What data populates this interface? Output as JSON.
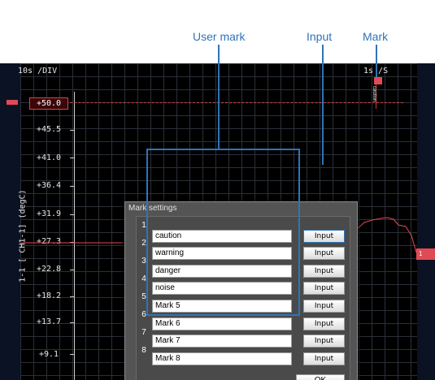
{
  "callouts": {
    "user_mark": "User mark",
    "input": "Input",
    "mark": "Mark"
  },
  "scope": {
    "time_div": "10s  /DIV",
    "sample_rate": "1s    /S",
    "trigger_level": "+50.0",
    "channel_label": "1-1 [ CH1-1] (degC)",
    "mark_caption": "caution",
    "flag_label": "1",
    "y_ticks": [
      "+45.5",
      "+41.0",
      "+36.4",
      "+31.9",
      "+27.3",
      "+22.8",
      "+18.2",
      "+13.7",
      "+9.1"
    ]
  },
  "dialog": {
    "title": "Mark settings",
    "ok_label": "OK",
    "rows": [
      {
        "num": "1",
        "value": "caution",
        "button": "Input"
      },
      {
        "num": "2",
        "value": "warning",
        "button": "Input"
      },
      {
        "num": "3",
        "value": "danger",
        "button": "Input"
      },
      {
        "num": "4",
        "value": "noise",
        "button": "Input"
      },
      {
        "num": "5",
        "value": "Mark 5",
        "button": "Input"
      },
      {
        "num": "6",
        "value": "Mark 6",
        "button": "Input"
      },
      {
        "num": "7",
        "value": "Mark 7",
        "button": "Input"
      },
      {
        "num": "8",
        "value": "Mark 8",
        "button": "Input"
      }
    ]
  },
  "colors": {
    "callout": "#2f74b8",
    "trace": "#e04a55",
    "dialog_bg": "#545454"
  }
}
